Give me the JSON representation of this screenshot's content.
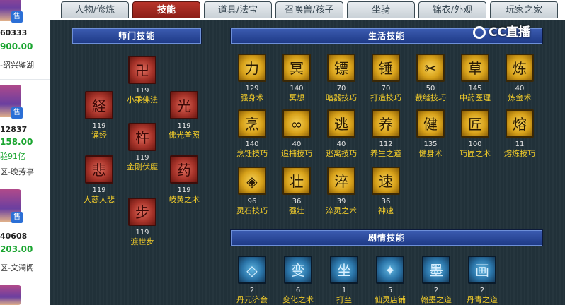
{
  "sidebar": {
    "sellers": [
      {
        "id": "60333",
        "price": "900.00",
        "server": "-绍兴鉴湖",
        "badge": "售"
      },
      {
        "id": "12837",
        "price": "158.00",
        "extra": "验91亿",
        "server": "区-晚芳亭",
        "badge": "售"
      },
      {
        "id": "40608",
        "price": "203.00",
        "server": "区-文澜阁",
        "badge": "售"
      }
    ]
  },
  "tabs": [
    {
      "label": "人物/修炼",
      "active": false
    },
    {
      "label": "技能",
      "active": true
    },
    {
      "label": "道具/法宝",
      "active": false
    },
    {
      "label": "召唤兽/孩子",
      "active": false
    },
    {
      "label": "坐骑",
      "active": false
    },
    {
      "label": "锦衣/外观",
      "active": false
    },
    {
      "label": "玩家之家",
      "active": false
    }
  ],
  "watermark": "CC直播",
  "school": {
    "title": "师门技能",
    "skills": [
      {
        "name": "小乘佛法",
        "level": "119",
        "icon": "swastika-icon"
      },
      {
        "name": "诵经",
        "level": "119",
        "icon": "scripture-icon"
      },
      {
        "name": "佛光普照",
        "level": "119",
        "icon": "buddha-light-icon"
      },
      {
        "name": "金刚伏魔",
        "level": "119",
        "icon": "vajra-icon"
      },
      {
        "name": "大慈大悲",
        "level": "119",
        "icon": "compassion-icon"
      },
      {
        "name": "岐黄之术",
        "level": "119",
        "icon": "medicine-icon"
      },
      {
        "name": "渡世步",
        "level": "119",
        "icon": "step-icon"
      }
    ]
  },
  "life": {
    "title": "生活技能",
    "skills": [
      {
        "name": "强身术",
        "level": "129",
        "icon": "strength-icon"
      },
      {
        "name": "冥想",
        "level": "140",
        "icon": "meditation-icon"
      },
      {
        "name": "暗器技巧",
        "level": "70",
        "icon": "dart-icon"
      },
      {
        "name": "打造技巧",
        "level": "70",
        "icon": "hammer-icon"
      },
      {
        "name": "裁缝技巧",
        "level": "50",
        "icon": "scissors-icon"
      },
      {
        "name": "中药医理",
        "level": "145",
        "icon": "herb-icon"
      },
      {
        "name": "炼金术",
        "level": "40",
        "icon": "alchemy-icon"
      },
      {
        "name": "烹饪技巧",
        "level": "140",
        "icon": "cooking-icon"
      },
      {
        "name": "追捕技巧",
        "level": "40",
        "icon": "pursuit-icon"
      },
      {
        "name": "逃离技巧",
        "level": "40",
        "icon": "escape-icon"
      },
      {
        "name": "养生之道",
        "level": "112",
        "icon": "health-icon"
      },
      {
        "name": "健身术",
        "level": "135",
        "icon": "fitness-icon"
      },
      {
        "name": "巧匠之术",
        "level": "100",
        "icon": "craftsman-icon"
      },
      {
        "name": "熔炼技巧",
        "level": "11",
        "icon": "smelting-icon"
      },
      {
        "name": "灵石技巧",
        "level": "96",
        "icon": "spirit-stone-icon"
      },
      {
        "name": "强壮",
        "level": "36",
        "icon": "muscle-icon"
      },
      {
        "name": "淬灵之术",
        "level": "39",
        "icon": "temper-icon"
      },
      {
        "name": "神速",
        "level": "36",
        "icon": "speed-icon"
      }
    ]
  },
  "story": {
    "title": "剧情技能",
    "skills": [
      {
        "name": "丹元济会",
        "level": "2",
        "icon": "dan-icon"
      },
      {
        "name": "变化之术",
        "level": "6",
        "icon": "transform-icon"
      },
      {
        "name": "打坐",
        "level": "1",
        "icon": "sit-icon"
      },
      {
        "name": "仙灵店铺",
        "level": "5",
        "icon": "shop-icon"
      },
      {
        "name": "翰墨之道",
        "level": "2",
        "icon": "ink-icon"
      },
      {
        "name": "丹青之道",
        "level": "2",
        "icon": "painting-icon"
      }
    ]
  }
}
